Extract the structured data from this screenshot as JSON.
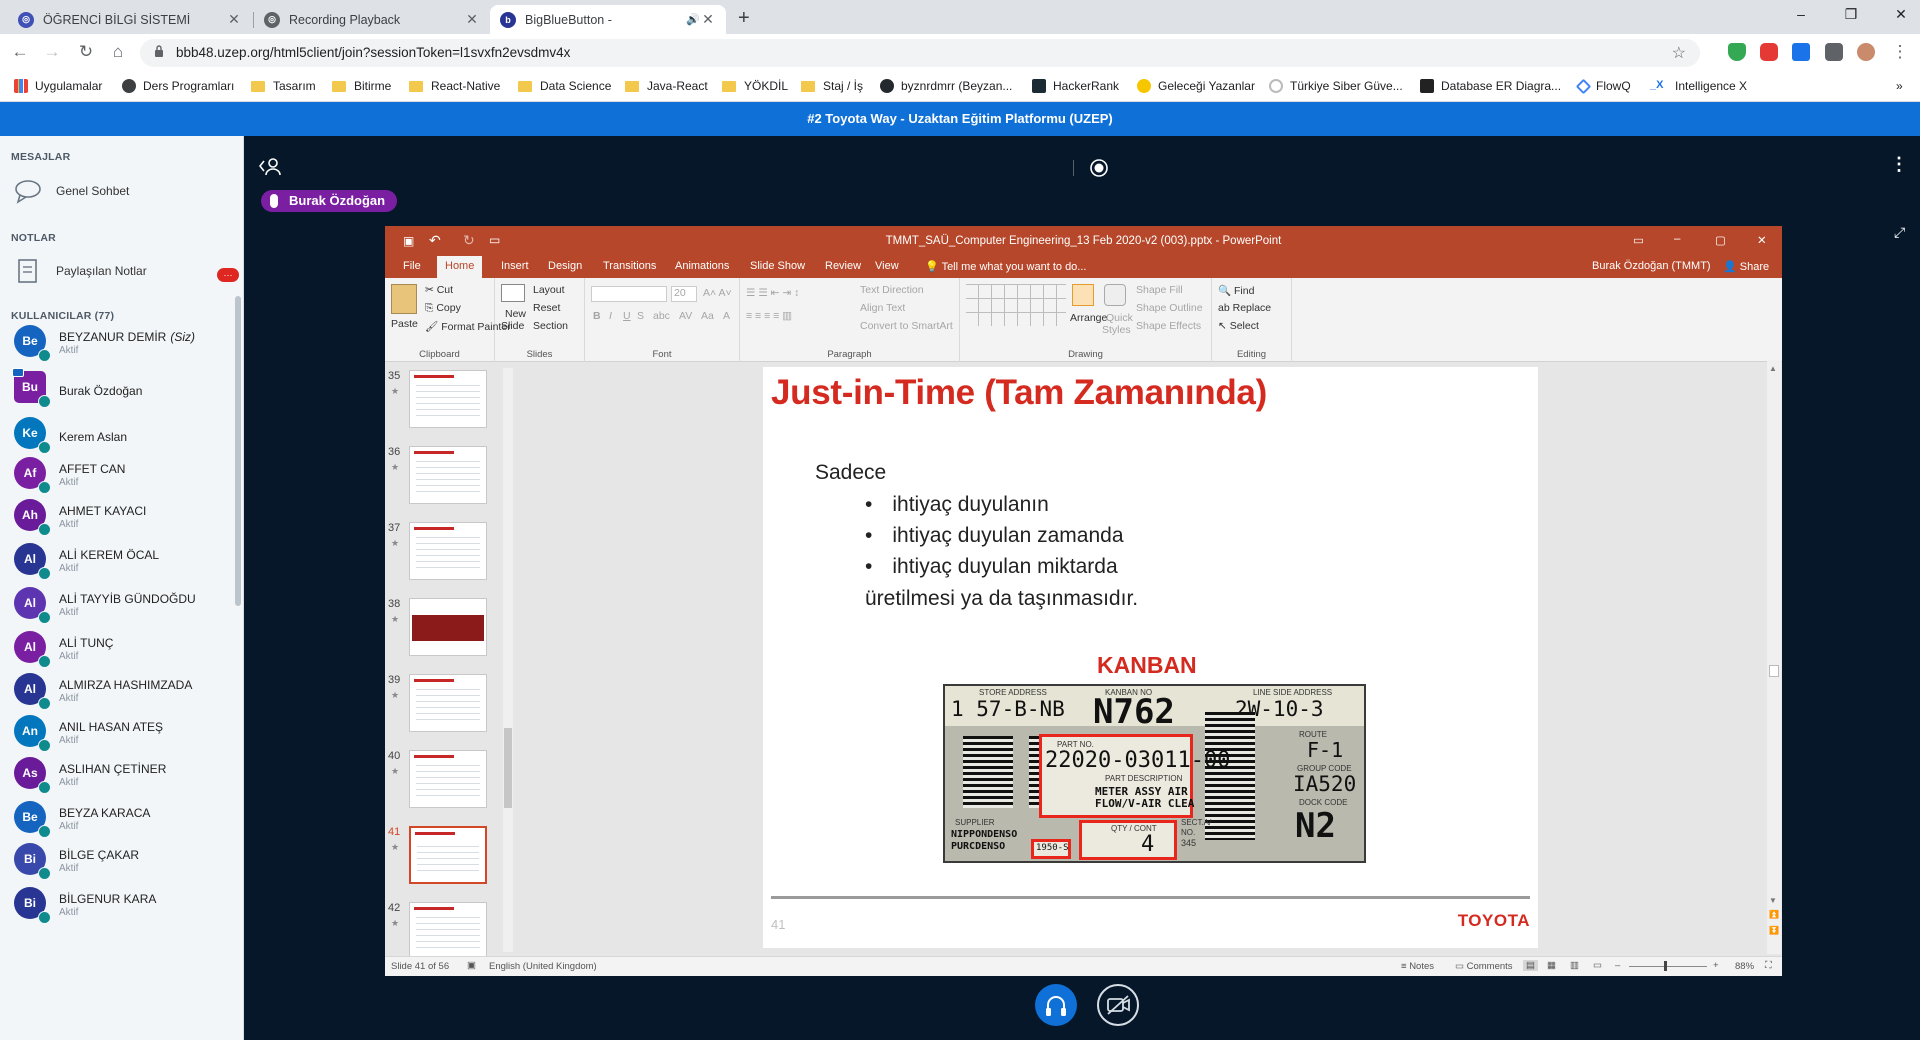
{
  "browser": {
    "tabs": [
      {
        "title": "ÖĞRENCİ BİLGİ SİSTEMİ",
        "favicon": "globe-icon"
      },
      {
        "title": "Recording Playback",
        "favicon": "globe-icon"
      },
      {
        "title": "BigBlueButton -",
        "favicon": "bbb-icon"
      }
    ],
    "new_tab": "+",
    "url": "bbb48.uzep.org/html5client/join?sessionToken=l1svxfn2evsdmv4x",
    "bookmarks": [
      {
        "label": "Uygulamalar",
        "kind": "apps"
      },
      {
        "label": "Ders Programları",
        "kind": "site"
      },
      {
        "label": "Tasarım",
        "kind": "folder"
      },
      {
        "label": "Bitirme",
        "kind": "folder"
      },
      {
        "label": "React-Native",
        "kind": "folder"
      },
      {
        "label": "Data Science",
        "kind": "folder"
      },
      {
        "label": "Java-React",
        "kind": "folder"
      },
      {
        "label": "YÖKDİL",
        "kind": "folder"
      },
      {
        "label": "Staj / İş",
        "kind": "folder"
      },
      {
        "label": "byznrdmrr (Beyzan...",
        "kind": "github"
      },
      {
        "label": "HackerRank",
        "kind": "site"
      },
      {
        "label": "Geleceği Yazanlar",
        "kind": "site"
      },
      {
        "label": "Türkiye Siber Güve...",
        "kind": "site"
      },
      {
        "label": "Database ER Diagra...",
        "kind": "site"
      },
      {
        "label": "FlowQ",
        "kind": "site"
      },
      {
        "label": "Intelligence X",
        "kind": "site"
      }
    ],
    "more_bookmarks": "»"
  },
  "banner": "#2 Toyota Way - Uzaktan Eğitim Platformu (UZEP)",
  "sidebar": {
    "messages_header": "MESAJLAR",
    "public_chat": "Genel Sohbet",
    "notes_header": "NOTLAR",
    "shared_notes": "Paylaşılan Notlar",
    "shared_notes_badge": "···",
    "users_header": "KULLANICILAR (77)",
    "users": [
      {
        "initials": "Be",
        "name": "BEYZANUR DEMİR",
        "you": "(Siz)",
        "status": "Aktif",
        "color": "#1565c0",
        "presenter": false
      },
      {
        "initials": "Bu",
        "name": "Burak Özdoğan",
        "you": "",
        "status": "",
        "color": "#7b1fa2",
        "presenter": true
      },
      {
        "initials": "Ke",
        "name": "Kerem Aslan",
        "you": "",
        "status": "",
        "color": "#0277bd",
        "presenter": false
      },
      {
        "initials": "Af",
        "name": "AFFET CAN",
        "you": "",
        "status": "Aktif",
        "color": "#7b1fa2",
        "presenter": false
      },
      {
        "initials": "Ah",
        "name": "AHMET KAYACI",
        "you": "",
        "status": "Aktif",
        "color": "#6a1b9a",
        "presenter": false
      },
      {
        "initials": "Al",
        "name": "ALİ KEREM ÖCAL",
        "you": "",
        "status": "Aktif",
        "color": "#283593",
        "presenter": false
      },
      {
        "initials": "Al",
        "name": "ALİ TAYYİB GÜNDOĞDU",
        "you": "",
        "status": "Aktif",
        "color": "#5e35b1",
        "presenter": false
      },
      {
        "initials": "Al",
        "name": "ALİ TUNÇ",
        "you": "",
        "status": "Aktif",
        "color": "#7b1fa2",
        "presenter": false
      },
      {
        "initials": "Al",
        "name": "ALMIRZA HASHIMZADA",
        "you": "",
        "status": "Aktif",
        "color": "#283593",
        "presenter": false
      },
      {
        "initials": "An",
        "name": "ANIL HASAN ATEŞ",
        "you": "",
        "status": "Aktif",
        "color": "#0277bd",
        "presenter": false
      },
      {
        "initials": "As",
        "name": "ASLIHAN ÇETİNER",
        "you": "",
        "status": "Aktif",
        "color": "#6a1b9a",
        "presenter": false
      },
      {
        "initials": "Be",
        "name": "BEYZA KARACA",
        "you": "",
        "status": "Aktif",
        "color": "#1565c0",
        "presenter": false
      },
      {
        "initials": "Bi",
        "name": "BİLGE ÇAKAR",
        "you": "",
        "status": "Aktif",
        "color": "#3949ab",
        "presenter": false
      },
      {
        "initials": "Bi",
        "name": "BİLGENUR KARA",
        "you": "",
        "status": "Aktif",
        "color": "#283593",
        "presenter": false
      }
    ]
  },
  "presenter_tag": "Burak Özdoğan",
  "ppt": {
    "title": "TMMT_SAÜ_Computer Engineering_13 Feb 2020-v2 (003).pptx - PowerPoint",
    "user": "Burak Özdoğan (TMMT)",
    "share": "Share",
    "tabs": [
      "File",
      "Home",
      "Insert",
      "Design",
      "Transitions",
      "Animations",
      "Slide Show",
      "Review",
      "View"
    ],
    "active_tab": "Home",
    "tell_me": "Tell me what you want to do...",
    "ribbon": {
      "clipboard": {
        "paste": "Paste",
        "cut": "Cut",
        "copy": "Copy",
        "format_painter": "Format Painter",
        "label": "Clipboard"
      },
      "slides": {
        "new_slide": "New",
        "new_slide2": "Slide",
        "layout": "Layout",
        "reset": "Reset",
        "section": "Section",
        "label": "Slides"
      },
      "font": {
        "size": "20",
        "label": "Font"
      },
      "paragraph": {
        "text_direction": "Text Direction",
        "align_text": "Align Text",
        "smartart": "Convert to SmartArt",
        "label": "Paragraph"
      },
      "drawing": {
        "arrange": "Arrange",
        "quick": "Quick",
        "styles": "Styles",
        "shape_fill": "Shape Fill",
        "shape_outline": "Shape Outline",
        "shape_effects": "Shape Effects",
        "label": "Drawing"
      },
      "editing": {
        "find": "Find",
        "replace": "Replace",
        "select": "Select",
        "label": "Editing"
      }
    },
    "thumbnails": [
      {
        "num": "35",
        "selected": false,
        "dark": false
      },
      {
        "num": "36",
        "selected": false,
        "dark": false
      },
      {
        "num": "37",
        "selected": false,
        "dark": false
      },
      {
        "num": "38",
        "selected": false,
        "dark": true
      },
      {
        "num": "39",
        "selected": false,
        "dark": false
      },
      {
        "num": "40",
        "selected": false,
        "dark": false
      },
      {
        "num": "41",
        "selected": true,
        "dark": false
      },
      {
        "num": "42",
        "selected": false,
        "dark": false
      }
    ],
    "slide": {
      "title": "Just-in-Time (Tam Zamanında)",
      "intro": "Sadece",
      "bullets": [
        "ihtiyaç duyulanın",
        "ihtiyaç duyulan zamanda",
        "ihtiyaç duyulan miktarda"
      ],
      "outro": "üretilmesi ya da taşınmasıdır.",
      "kanban_label": "KANBAN",
      "kanban": {
        "store_address_label": "STORE ADDRESS",
        "store_address": "1 57-B-NB",
        "kanban_no_label": "KANBAN NO",
        "kanban_no": "N762",
        "line_side_label": "LINE SIDE ADDRESS",
        "line_side": "2W-10-3",
        "part_no_label": "PART NO.",
        "part_no": "22020-03011-00",
        "part_desc_label": "PART DESCRIPTION",
        "part_desc_1": "METER ASSY AIR",
        "part_desc_2": "FLOW/V-AIR CLEA",
        "route_label": "ROUTE",
        "route": "F-1",
        "group_label": "GROUP CODE",
        "group": "IA520",
        "dock_label": "DOCK CODE",
        "dock": "N2",
        "supplier_label": "SUPPLIER",
        "supplier_1": "NIPPONDENSO",
        "supplier_2": "PURCDENSO",
        "supplier_code": "1950-S",
        "qty_label": "QTY / CONT",
        "qty": "4",
        "sect_label": "SECT.A/",
        "sect_no_label": "NO.",
        "sect_no": "345"
      },
      "slide_number": "41",
      "logo": "TOYOTA"
    },
    "status": {
      "slide": "Slide 41 of 56",
      "language": "English (United Kingdom)",
      "notes": "Notes",
      "comments": "Comments",
      "zoom": "88%"
    }
  },
  "colors": {
    "accent": "#0f70d7",
    "ppt": "#b7472a",
    "slide_red": "#d42a20",
    "dark_bg": "#06172a"
  }
}
